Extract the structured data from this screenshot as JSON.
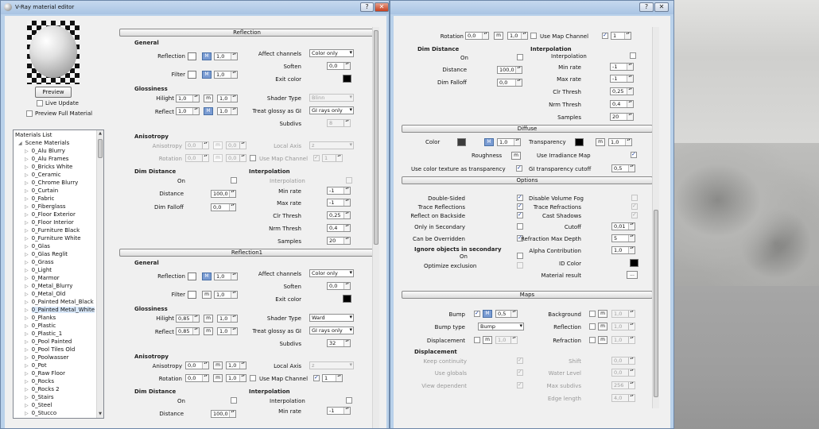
{
  "window": {
    "title": "V-Ray material editor",
    "help_btn": "?",
    "close_btn": "✕"
  },
  "preview": {
    "button": "Preview",
    "live_update": "Live Update",
    "preview_full": "Preview Full Material",
    "live_update_checked": false,
    "preview_full_checked": false
  },
  "materials": {
    "title": "Materials List",
    "root": "Scene Materials",
    "items": [
      "0_Alu Blurry",
      "0_Alu Frames",
      "0_Bricks White",
      "0_Ceramic",
      "0_Chrome Blurry",
      "0_Curtain",
      "0_Fabric",
      "0_Fiberglass",
      "0_Floor Exterior",
      "0_Floor Interior",
      "0_Furniture Black",
      "0_Furniture White",
      "0_Glas",
      "0_Glas Reglit",
      "0_Grass",
      "0_Light",
      "0_Marmor",
      "0_Metal_Blurry",
      "0_Metal_Old",
      "0_Painted Metal_Black",
      "0_Painted Metal_White",
      "0_Planks",
      "0_Plastic",
      "0_Plastic_1",
      "0_Pool Painted",
      "0_Pool Tiles Old",
      "0_Poolwasser",
      "0_Pot",
      "0_Raw Floor",
      "0_Rocks",
      "0_Rocks 2",
      "0_Stairs",
      "0_Steel",
      "0_Stucco"
    ],
    "selected": "0_Painted Metal_White"
  },
  "reflection": {
    "title": "Reflection",
    "general": "General",
    "reflection_label": "Reflection",
    "reflection_value": "1,0",
    "reflection_color": "#ffffff",
    "filter_label": "Filter",
    "filter_value": "1,0",
    "filter_color": "#ffffff",
    "affect_label": "Affect channels",
    "affect_value": "Color only",
    "soften_label": "Soften",
    "soften_value": "0,0",
    "exit_label": "Exit color",
    "exit_color": "#000000",
    "glossiness": "Glossiness",
    "hilight_label": "Hilight",
    "hilight_a": "1,0",
    "hilight_b": "1,0",
    "reflect_label": "Reflect",
    "reflect_a": "1,0",
    "reflect_b": "1,0",
    "shader_label": "Shader Type",
    "shader_value": "Blinn",
    "glossy_gi_label": "Treat glossy as GI",
    "glossy_gi_value": "GI rays only",
    "subdivs_label": "Subdivs",
    "subdivs_value": "8",
    "anisotropy": "Anisotropy",
    "aniso_label": "Anisotropy",
    "aniso_a": "0,0",
    "aniso_b": "0,0",
    "rotation_label": "Rotation",
    "rotation_a": "0,0",
    "rotation_b": "0,0",
    "local_axis_label": "Local Axis",
    "local_axis_value": "z",
    "use_map_channel": "Use Map Channel",
    "map_channel_value": "1",
    "dim_distance": "Dim Distance",
    "on_label": "On",
    "distance_label": "Distance",
    "distance_value": "100,0",
    "dim_falloff_label": "Dim Falloff",
    "dim_falloff_value": "0,0",
    "interpolation": "Interpolation",
    "interp_label": "Interpolation",
    "min_rate_label": "Min rate",
    "min_rate": "-1",
    "max_rate_label": "Max rate",
    "max_rate": "-1",
    "clr_thresh_label": "Clr Thresh",
    "clr_thresh": "0,25",
    "nrm_thresh_label": "Nrm Thresh",
    "nrm_thresh": "0,4",
    "samples_label": "Samples",
    "samples": "20"
  },
  "reflection1": {
    "title": "Reflection1",
    "general": "General",
    "reflection_value": "1,0",
    "filter_value": "1,0",
    "affect_value": "Color only",
    "soften_value": "0,0",
    "glossiness": "Glossiness",
    "hilight_a": "0,85",
    "hilight_b": "1,0",
    "reflect_a": "0,85",
    "reflect_b": "1,0",
    "shader_value": "Ward",
    "glossy_gi_value": "GI rays only",
    "subdivs_value": "32",
    "anisotropy": "Anisotropy",
    "aniso_a": "0,0",
    "aniso_b": "1,0",
    "rotation_a": "0,0",
    "rotation_b": "1,0",
    "local_axis_value": "z",
    "map_channel_value": "1",
    "dim_distance": "Dim Distance",
    "interpolation": "Interpolation",
    "distance_value": "100,0",
    "min_rate": "-1"
  },
  "right": {
    "rotation_label": "Rotation",
    "rotation_a": "0,0",
    "rotation_b": "1,0",
    "use_map_channel": "Use Map Channel",
    "map_channel_value": "1",
    "dim_distance": "Dim Distance",
    "on_label": "On",
    "distance_label": "Distance",
    "distance_value": "100,0",
    "dim_falloff_label": "Dim Falloff",
    "dim_falloff_value": "0,0",
    "interpolation": "Interpolation",
    "interp_label": "Interpolation",
    "min_rate_label": "Min rate",
    "min_rate": "-1",
    "max_rate_label": "Max rate",
    "max_rate": "-1",
    "clr_thresh_label": "Clr Thresh",
    "clr_thresh": "0,25",
    "nrm_thresh_label": "Nrm Thresh",
    "nrm_thresh": "0,4",
    "samples_label": "Samples",
    "samples": "20",
    "diffuse": {
      "title": "Diffuse",
      "color_label": "Color",
      "color": "#3c3c3c",
      "color_value": "1,0",
      "transparency_label": "Transparency",
      "transparency_color": "#000000",
      "transparency_value": "1,0",
      "roughness_label": "Roughness",
      "use_irradiance_map": "Use Irradiance Map",
      "use_color_tex": "Use color texture as transparency",
      "gi_cutoff_label": "GI transparency cutoff",
      "gi_cutoff": "0,5"
    },
    "options": {
      "title": "Options",
      "double_sided": "Double-Sided",
      "trace_reflections": "Trace Reflections",
      "reflect_backside": "Reflect on Backside",
      "only_secondary": "Only in Secondary",
      "can_override": "Can be Overridden",
      "disable_fog": "Disable Volume Fog",
      "trace_refractions": "Trace Refractions",
      "cast_shadows": "Cast Shadows",
      "cutoff_label": "Cutoff",
      "cutoff": "0,01",
      "refr_depth_label": "Refraction Max Depth",
      "refr_depth": "5",
      "ignore_title": "Ignore objects in secondary",
      "on_label": "On",
      "optimize_label": "Optimize exclusion",
      "alpha_label": "Alpha Contribution",
      "alpha": "1,0",
      "id_color_label": "ID Color",
      "id_color": "#000000",
      "material_result": "Material result",
      "material_btn": "..."
    },
    "maps": {
      "title": "Maps",
      "bump_label": "Bump",
      "bump_value": "0,5",
      "bump_type_label": "Bump type",
      "bump_type": "Bump",
      "displacement_label": "Displacement",
      "displacement_value": "1,0",
      "background_label": "Background",
      "background_value": "1,0",
      "reflection_label": "Reflection",
      "reflection_value": "1,0",
      "refraction_label": "Refraction",
      "refraction_value": "1,0",
      "disp_section": "Displacement",
      "keep_continuity": "Keep continuity",
      "use_globals": "Use globals",
      "view_dependent": "View dependent",
      "shift_label": "Shift",
      "shift": "0,0",
      "water_label": "Water Level",
      "water": "0,0",
      "max_subdivs_label": "Max subdivs",
      "max_subdivs": "256",
      "edge_label": "Edge length",
      "edge": "4,0"
    }
  },
  "m_label": "m",
  "M_label": "M"
}
